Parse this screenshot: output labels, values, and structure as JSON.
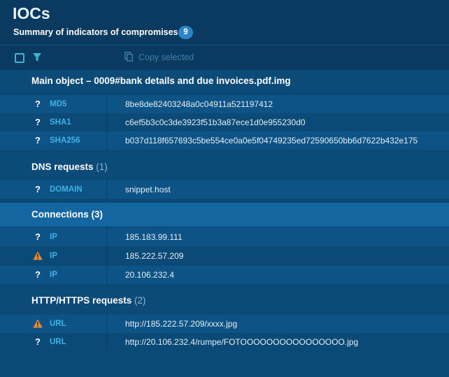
{
  "header": {
    "title": "IOCs",
    "subtitle": "Summary of indicators of compromises",
    "count": "9"
  },
  "toolbar": {
    "copy_label": "Copy selected"
  },
  "sections": [
    {
      "title": "Main object – 0009#bank details and due invoices.pdf.img",
      "count": "",
      "rows": [
        {
          "status": "?",
          "type": "MD5",
          "value": "8be8de82403248a0c04911a521197412"
        },
        {
          "status": "?",
          "type": "SHA1",
          "value": "c6ef5b3c0c3de3923f51b3a87ece1d0e955230d0"
        },
        {
          "status": "?",
          "type": "SHA256",
          "value": "b037d118f657693c5be554ce0a0e5f04749235ed72590650bb6d7622b432e175"
        }
      ]
    },
    {
      "title": "DNS requests",
      "count": "(1)",
      "rows": [
        {
          "status": "?",
          "type": "DOMAIN",
          "value": "snippet.host"
        }
      ]
    },
    {
      "title": "Connections (3)",
      "count": "",
      "rows": [
        {
          "status": "?",
          "type": "IP",
          "value": "185.183.99.111"
        },
        {
          "status": "warning",
          "type": "IP",
          "value": "185.222.57.209"
        },
        {
          "status": "?",
          "type": "IP",
          "value": "20.106.232.4"
        }
      ]
    },
    {
      "title": "HTTP/HTTPS requests",
      "count": "(2)",
      "rows": [
        {
          "status": "warning",
          "type": "URL",
          "value": "http://185.222.57.209/xxxx.jpg"
        },
        {
          "status": "?",
          "type": "URL",
          "value": "http://20.106.232.4/rumpe/FOTOOOOOOOOOOOOOOOO.jpg"
        }
      ]
    }
  ],
  "colors": {
    "background": "#0b4a76",
    "header": "#0a3a60",
    "type_label": "#3cb3e6",
    "badge": "#2a86c9",
    "warning": "#f08c2c"
  }
}
